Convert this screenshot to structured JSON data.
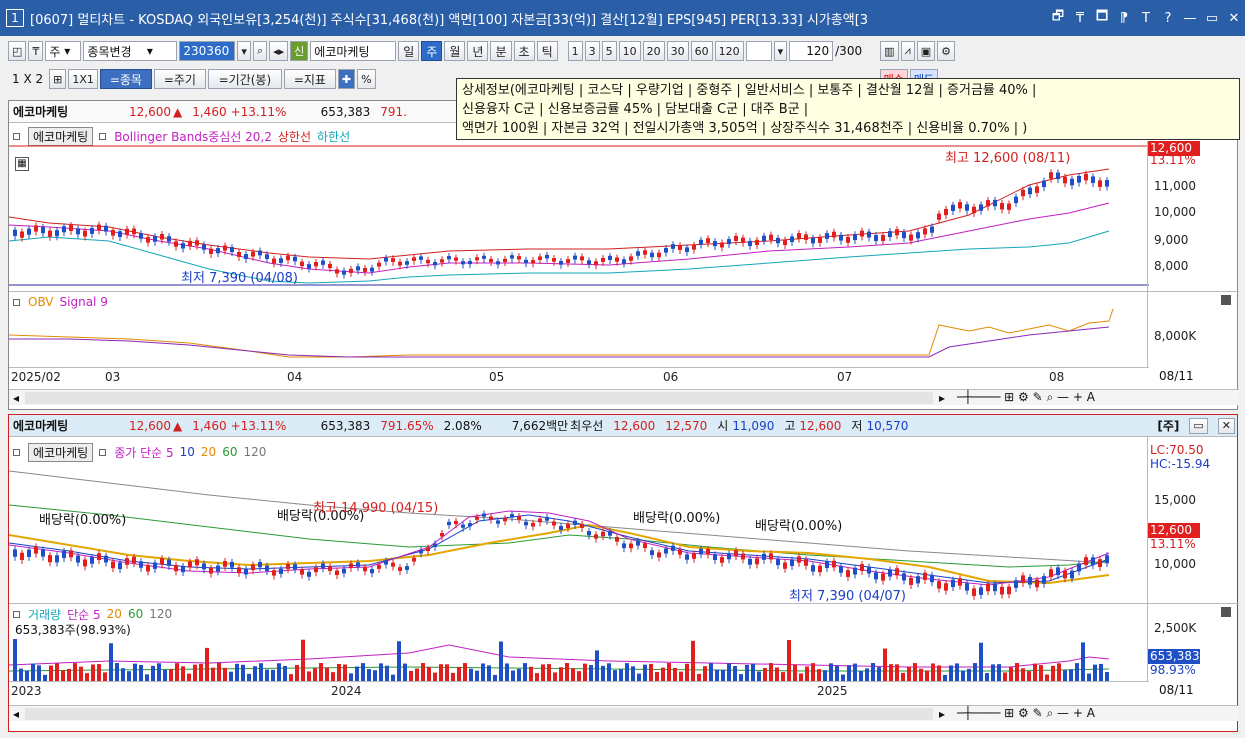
{
  "titlebar": {
    "num": "1",
    "title": "[0607] 멀티차트 - KOSDAQ 외국인보유[3,254(천)] 주식수[31,468(천)] 액면[100] 자본금[33(억)] 결산[12월] EPS[945] PER[13.33] 시가총액[3",
    "buttons": [
      "🗗",
      "₸",
      "🗖",
      "⁋",
      "T",
      "?",
      "—",
      "▭",
      "✕"
    ]
  },
  "toolbar1": {
    "zu": "주",
    "change": "종목변경",
    "code": "230360",
    "shin": "신",
    "name": "에코마케팅",
    "periods": [
      "일",
      "주",
      "월",
      "년",
      "분",
      "초",
      "틱"
    ],
    "nums": [
      "1",
      "3",
      "5",
      "10",
      "20",
      "30",
      "60",
      "120"
    ],
    "count": "120",
    "total": "/300"
  },
  "toolbar2": {
    "layout": "1 X 2",
    "one": "1X1",
    "b1": "=종목",
    "b2": "=주기",
    "b3": "=기간(봉)",
    "b4": "=지표",
    "pct": "%",
    "buy": "매수",
    "sell": "매도"
  },
  "tooltip": {
    "lines": [
      "상세정보(에코마케팅 | 코스닥 | 우량기업 | 중형주 | 일반서비스 | 보통주 | 결산월 12월 | 증거금률 40% |",
      "신용융자 C군 | 신용보증금률 45% | 담보대출 C군 | 대주 B군 |",
      "액면가 100원 | 자본금 32억 | 전일시가총액 3,505억 | 상장주식수 31,468천주 | 신용비율 0.70% | )"
    ]
  },
  "top": {
    "info": {
      "name": "에코마케팅",
      "price": "12,600",
      "arrow": "▲",
      "chg": "1,460",
      "pct": "+13.11%",
      "vol": "653,383",
      "vr": "791."
    },
    "legend": {
      "name": "에코마케팅",
      "ind": "Bollinger Bands중심선 20,2",
      "up": "상한선",
      "down": "하한선"
    },
    "high": "최고 12,600 (08/11)",
    "low": "최저 7,390 (04/08)",
    "yticks": [
      "11,000",
      "10,000",
      "9,000",
      "8,000"
    ],
    "ptag": "12,600",
    "ptag2": "13.11%",
    "obv": {
      "name": "OBV",
      "sig": "Signal 9",
      "tick": "8,000K"
    },
    "xlabels": [
      "2025/02",
      "03",
      "04",
      "05",
      "06",
      "07",
      "08"
    ],
    "xend": "08/11"
  },
  "bottom": {
    "info": {
      "name": "에코마케팅",
      "price": "12,600",
      "arrow": "▲",
      "chg": "1,460",
      "pct": "+13.11%",
      "vol": "653,383",
      "vr": "791.65%",
      "turn": "2.08%",
      "amt": "7,662백만",
      "best": "최우선",
      "b1": "12,600",
      "b2": "12,570",
      "o": "시",
      "ov": "11,090",
      "h": "고",
      "hv": "12,600",
      "l": "저",
      "lv": "10,570",
      "ju": "[주]"
    },
    "legend": {
      "name": "에코마케팅",
      "ma": "종가 단순 5",
      "m10": "10",
      "m20": "20",
      "m60": "60",
      "m120": "120"
    },
    "lc": "LC:70.50",
    "hc": "HC:-15.94",
    "yticks": [
      "15,000",
      "10,000"
    ],
    "ptag": "12,600",
    "ptag2": "13.11%",
    "ann": {
      "d1": "배당락(0.00%)",
      "d2": "배당락(0.00%)",
      "d3": "배당락(0.00%)",
      "d4": "배당락(0.00%)",
      "high": "최고 14,990 (04/15)",
      "low": "최저 7,390 (04/07)"
    },
    "vol": {
      "name": "거래량",
      "ma": "단순 5",
      "m20": "20",
      "m60": "60",
      "m120": "120",
      "last": "653,383주(98.93%)",
      "tick": "2,500K",
      "tag": "653,383",
      "tag2": "98.93%"
    },
    "xlabels": [
      "2023",
      "2024",
      "2025"
    ],
    "xend": "08/11"
  }
}
